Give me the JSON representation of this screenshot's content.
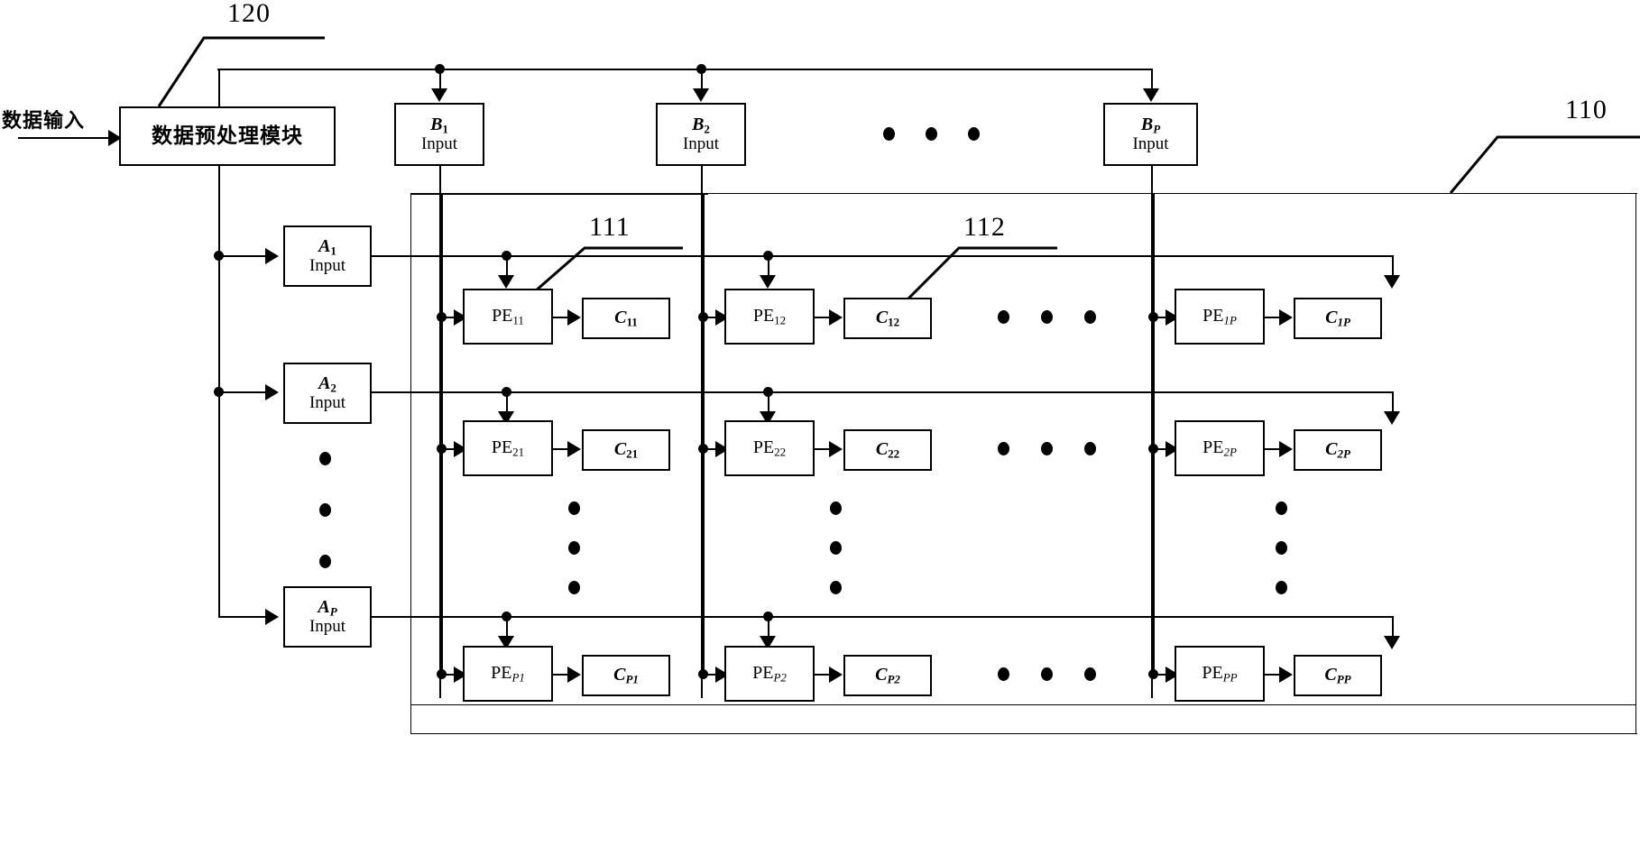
{
  "diagram": {
    "title": "Matrix multiplication systolic PE array architecture",
    "type": "block-diagram",
    "language": "zh-CN + en"
  },
  "labels": {
    "data_input": "数据输入",
    "preprocess_module": "数据预处理模块",
    "ref_120": "120",
    "ref_110": "110",
    "ref_111": "111",
    "ref_112": "112"
  },
  "b_inputs": [
    {
      "name": "B",
      "sub": "1",
      "sub_italic": false,
      "line2": "Input"
    },
    {
      "name": "B",
      "sub": "2",
      "sub_italic": false,
      "line2": "Input"
    },
    {
      "name": "B",
      "sub": "P",
      "sub_italic": true,
      "line2": "Input"
    }
  ],
  "a_inputs": [
    {
      "name": "A",
      "sub": "1",
      "sub_italic": false,
      "line2": "Input"
    },
    {
      "name": "A",
      "sub": "2",
      "sub_italic": false,
      "line2": "Input"
    },
    {
      "name": "A",
      "sub": "P",
      "sub_italic": true,
      "line2": "Input"
    }
  ],
  "pe_grid": {
    "rows": 3,
    "cols": 3,
    "row_ids": [
      "1",
      "2",
      "P"
    ],
    "col_ids": [
      "1",
      "2",
      "P"
    ],
    "cells": [
      [
        {
          "pe": "PE",
          "pe_sub": "11",
          "pe_sub_italic": false,
          "c": "C",
          "c_sub": "11",
          "c_sub_italic": false
        },
        {
          "pe": "PE",
          "pe_sub": "12",
          "pe_sub_italic": false,
          "c": "C",
          "c_sub": "12",
          "c_sub_italic": false
        },
        {
          "pe": "PE",
          "pe_sub": "1P",
          "pe_sub_italic": true,
          "c": "C",
          "c_sub": "1P",
          "c_sub_italic": true
        }
      ],
      [
        {
          "pe": "PE",
          "pe_sub": "21",
          "pe_sub_italic": false,
          "c": "C",
          "c_sub": "21",
          "c_sub_italic": false
        },
        {
          "pe": "PE",
          "pe_sub": "22",
          "pe_sub_italic": false,
          "c": "C",
          "c_sub": "22",
          "c_sub_italic": false
        },
        {
          "pe": "PE",
          "pe_sub": "2P",
          "pe_sub_italic": true,
          "c": "C",
          "c_sub": "2P",
          "c_sub_italic": true
        }
      ],
      [
        {
          "pe": "PE",
          "pe_sub": "P1",
          "pe_sub_italic": true,
          "c": "C",
          "c_sub": "P1",
          "c_sub_italic": true
        },
        {
          "pe": "PE",
          "pe_sub": "P2",
          "pe_sub_italic": true,
          "c": "C",
          "c_sub": "P2",
          "c_sub_italic": true
        },
        {
          "pe": "PE",
          "pe_sub": "PP",
          "pe_sub_italic": true,
          "c": "C",
          "c_sub": "PP",
          "c_sub_italic": true
        }
      ]
    ]
  },
  "ellipses": {
    "horizontal_glyph": "•",
    "vertical_glyph": "•",
    "note": "ellipsis dot groups indicating continuation of the P x P array"
  },
  "colors": {
    "stroke": "#000000",
    "background": "#ffffff"
  }
}
